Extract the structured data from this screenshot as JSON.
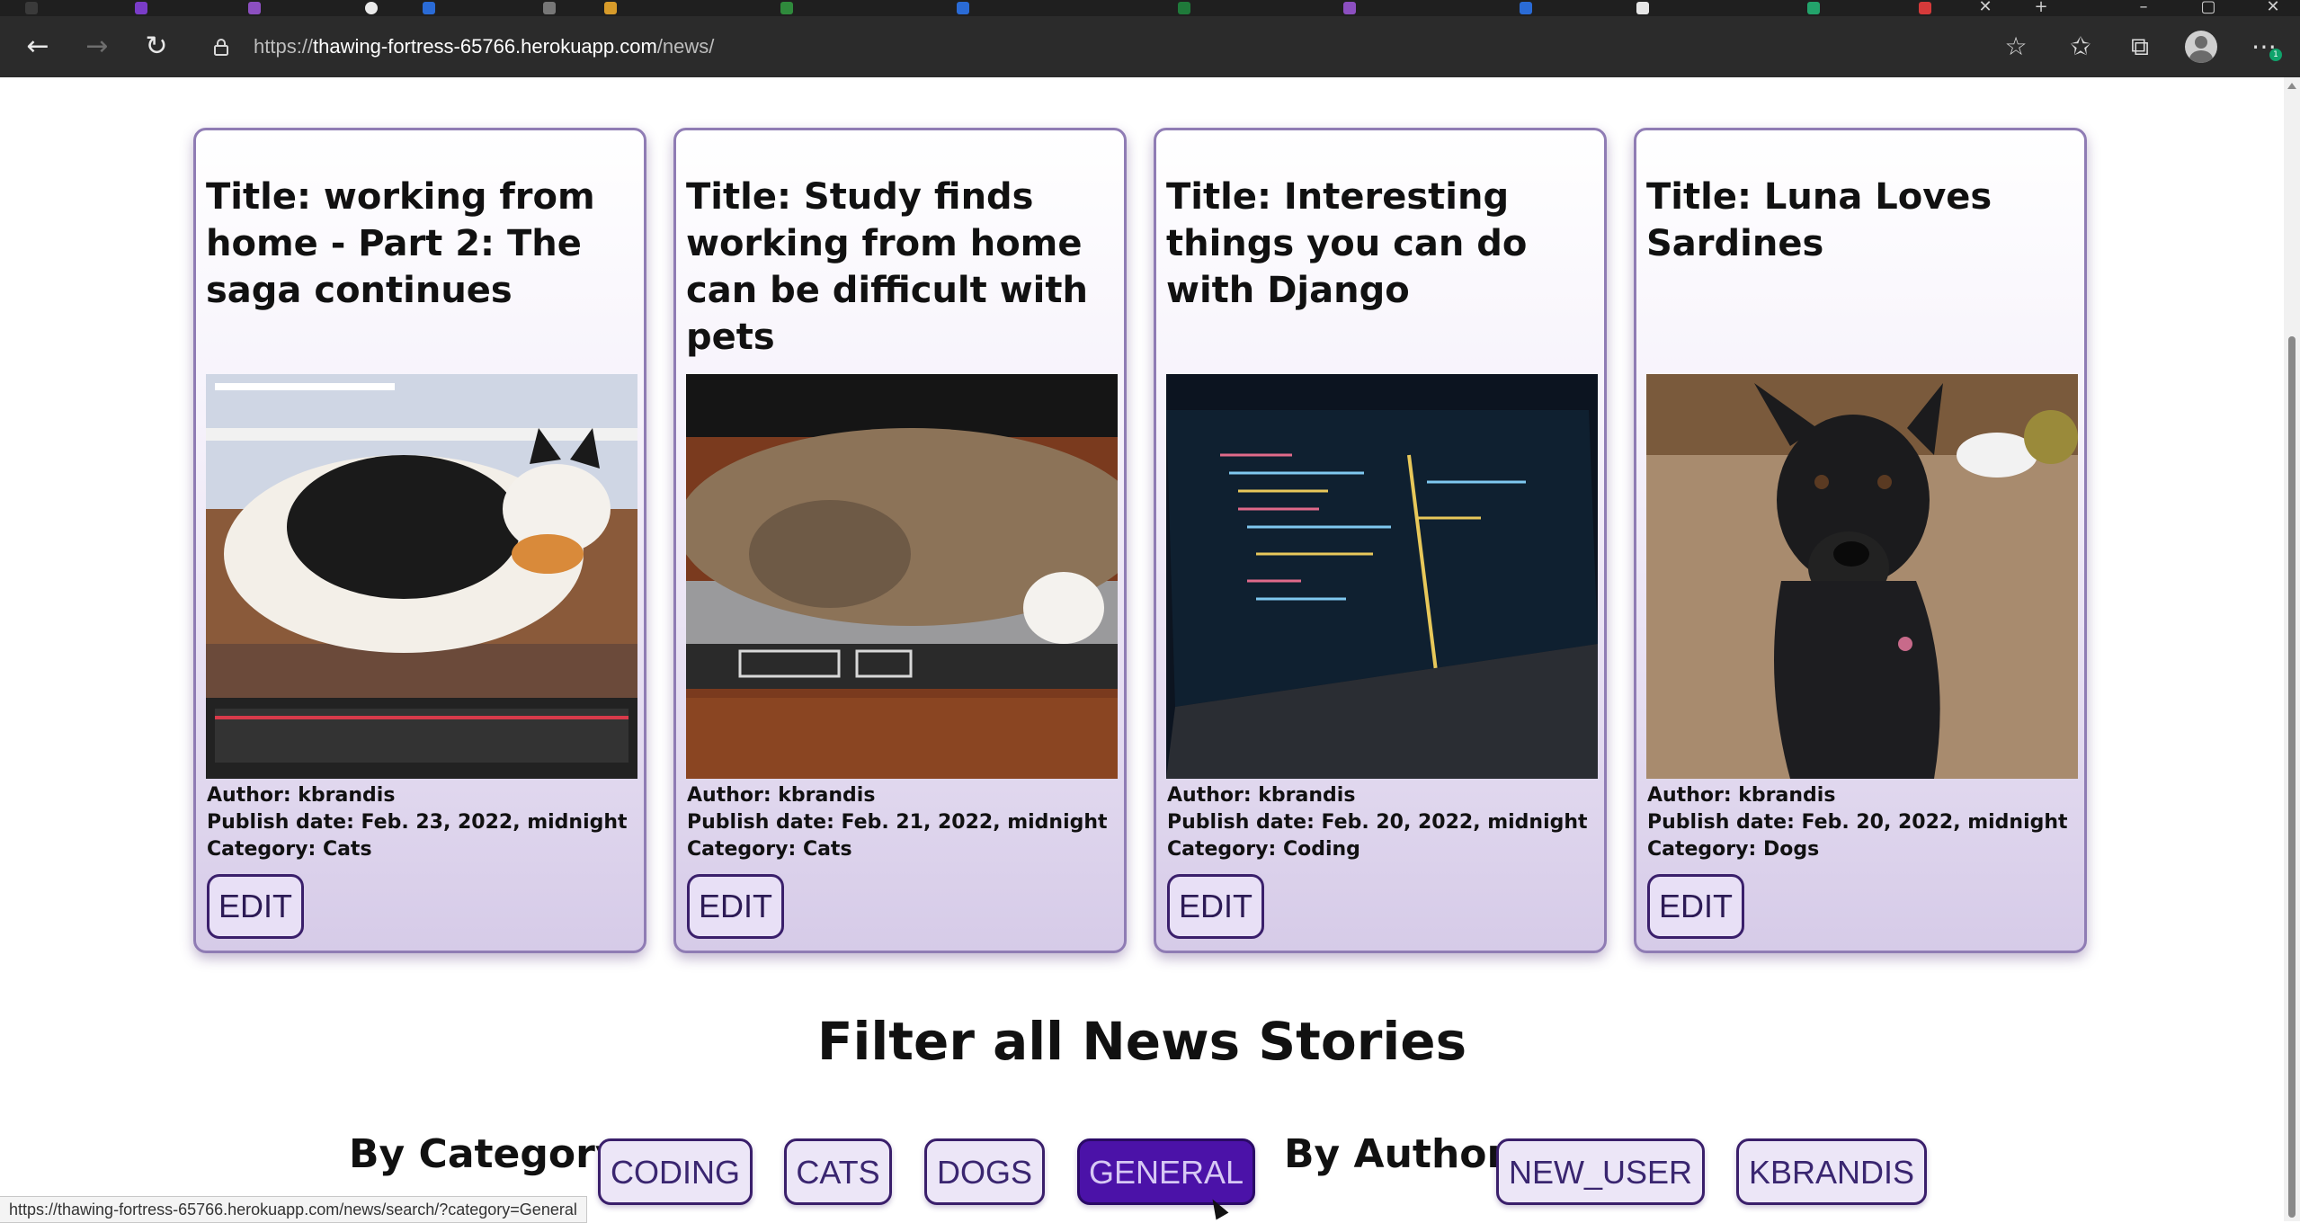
{
  "browser": {
    "url_scheme": "https://",
    "url_host": "thawing-fortress-65766.herokuapp.com",
    "url_path": "/news/",
    "notification_count": "1"
  },
  "news": [
    {
      "title": "Title: working from home - Part 2: The saga continues",
      "author": "Author: kbrandis",
      "date": "Publish date: Feb. 23, 2022, midnight",
      "category": "Category: Cats",
      "edit_label": "EDIT",
      "image": "cat-on-keyboard-photo"
    },
    {
      "title": "Title: Study finds working from home can be difficult with pets",
      "author": "Author: kbrandis",
      "date": "Publish date: Feb. 21, 2022, midnight",
      "category": "Category: Cats",
      "edit_label": "EDIT",
      "image": "tabby-cat-on-laptop-photo"
    },
    {
      "title": "Title: Interesting things you can do with Django",
      "author": "Author: kbrandis",
      "date": "Publish date: Feb. 20, 2022, midnight",
      "category": "Category: Coding",
      "edit_label": "EDIT",
      "image": "laptop-code-photo"
    },
    {
      "title": "Title: Luna Loves Sardines",
      "author": "Author: kbrandis",
      "date": "Publish date: Feb. 20, 2022, midnight",
      "category": "Category: Dogs",
      "edit_label": "EDIT",
      "image": "black-dog-photo"
    }
  ],
  "filter": {
    "heading": "Filter all News Stories",
    "category_label": "By Category",
    "categories": [
      "CODING",
      "CATS",
      "DOGS",
      "GENERAL"
    ],
    "active_category": "GENERAL",
    "author_label": "By Author",
    "authors": [
      "NEW_USER",
      "KBRANDIS"
    ]
  },
  "status_bar": {
    "link": "https://thawing-fortress-65766.herokuapp.com/news/search/?category=General"
  },
  "colors": {
    "active_button": "#4b12a8",
    "card_border": "#8f7cb4",
    "button_border": "#3a1f6b"
  }
}
